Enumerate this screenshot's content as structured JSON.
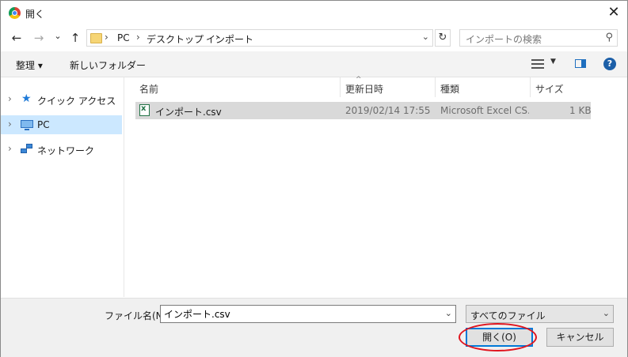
{
  "window": {
    "title": "開く",
    "close_glyph": "✕"
  },
  "nav": {
    "back_glyph": "←",
    "forward_glyph": "→",
    "recent_glyph": "⌄",
    "up_glyph": "↑",
    "breadcrumb": [
      "PC",
      "デスクトップ",
      "インポート"
    ],
    "separator": "›",
    "refresh_glyph": "↻",
    "search_placeholder": "インポートの検索"
  },
  "toolbar": {
    "organize_label": "整理 ▾",
    "new_folder_label": "新しいフォルダー",
    "help_glyph": "?"
  },
  "sidebar": {
    "items": [
      {
        "label": "クイック アクセス",
        "icon": "star-icon",
        "selected": false
      },
      {
        "label": "PC",
        "icon": "computer-icon",
        "selected": true
      },
      {
        "label": "ネットワーク",
        "icon": "network-icon",
        "selected": false
      }
    ]
  },
  "columns": [
    "名前",
    "更新日時",
    "種類",
    "サイズ"
  ],
  "files": [
    {
      "name": "インポート.csv",
      "modified": "2019/02/14 17:55",
      "type": "Microsoft Excel CS...",
      "size": "1 KB",
      "icon": "excel-csv-icon"
    }
  ],
  "footer": {
    "filename_label": "ファイル名(N):",
    "filename_value": "インポート.csv",
    "filetype_value": "すべてのファイル",
    "open_label": "開く(O)",
    "cancel_label": "キャンセル"
  },
  "colors": {
    "selection": "#cce8ff",
    "row_highlight": "#d9d9d9",
    "annotation": "#e0141e",
    "accent": "#0078d7"
  }
}
